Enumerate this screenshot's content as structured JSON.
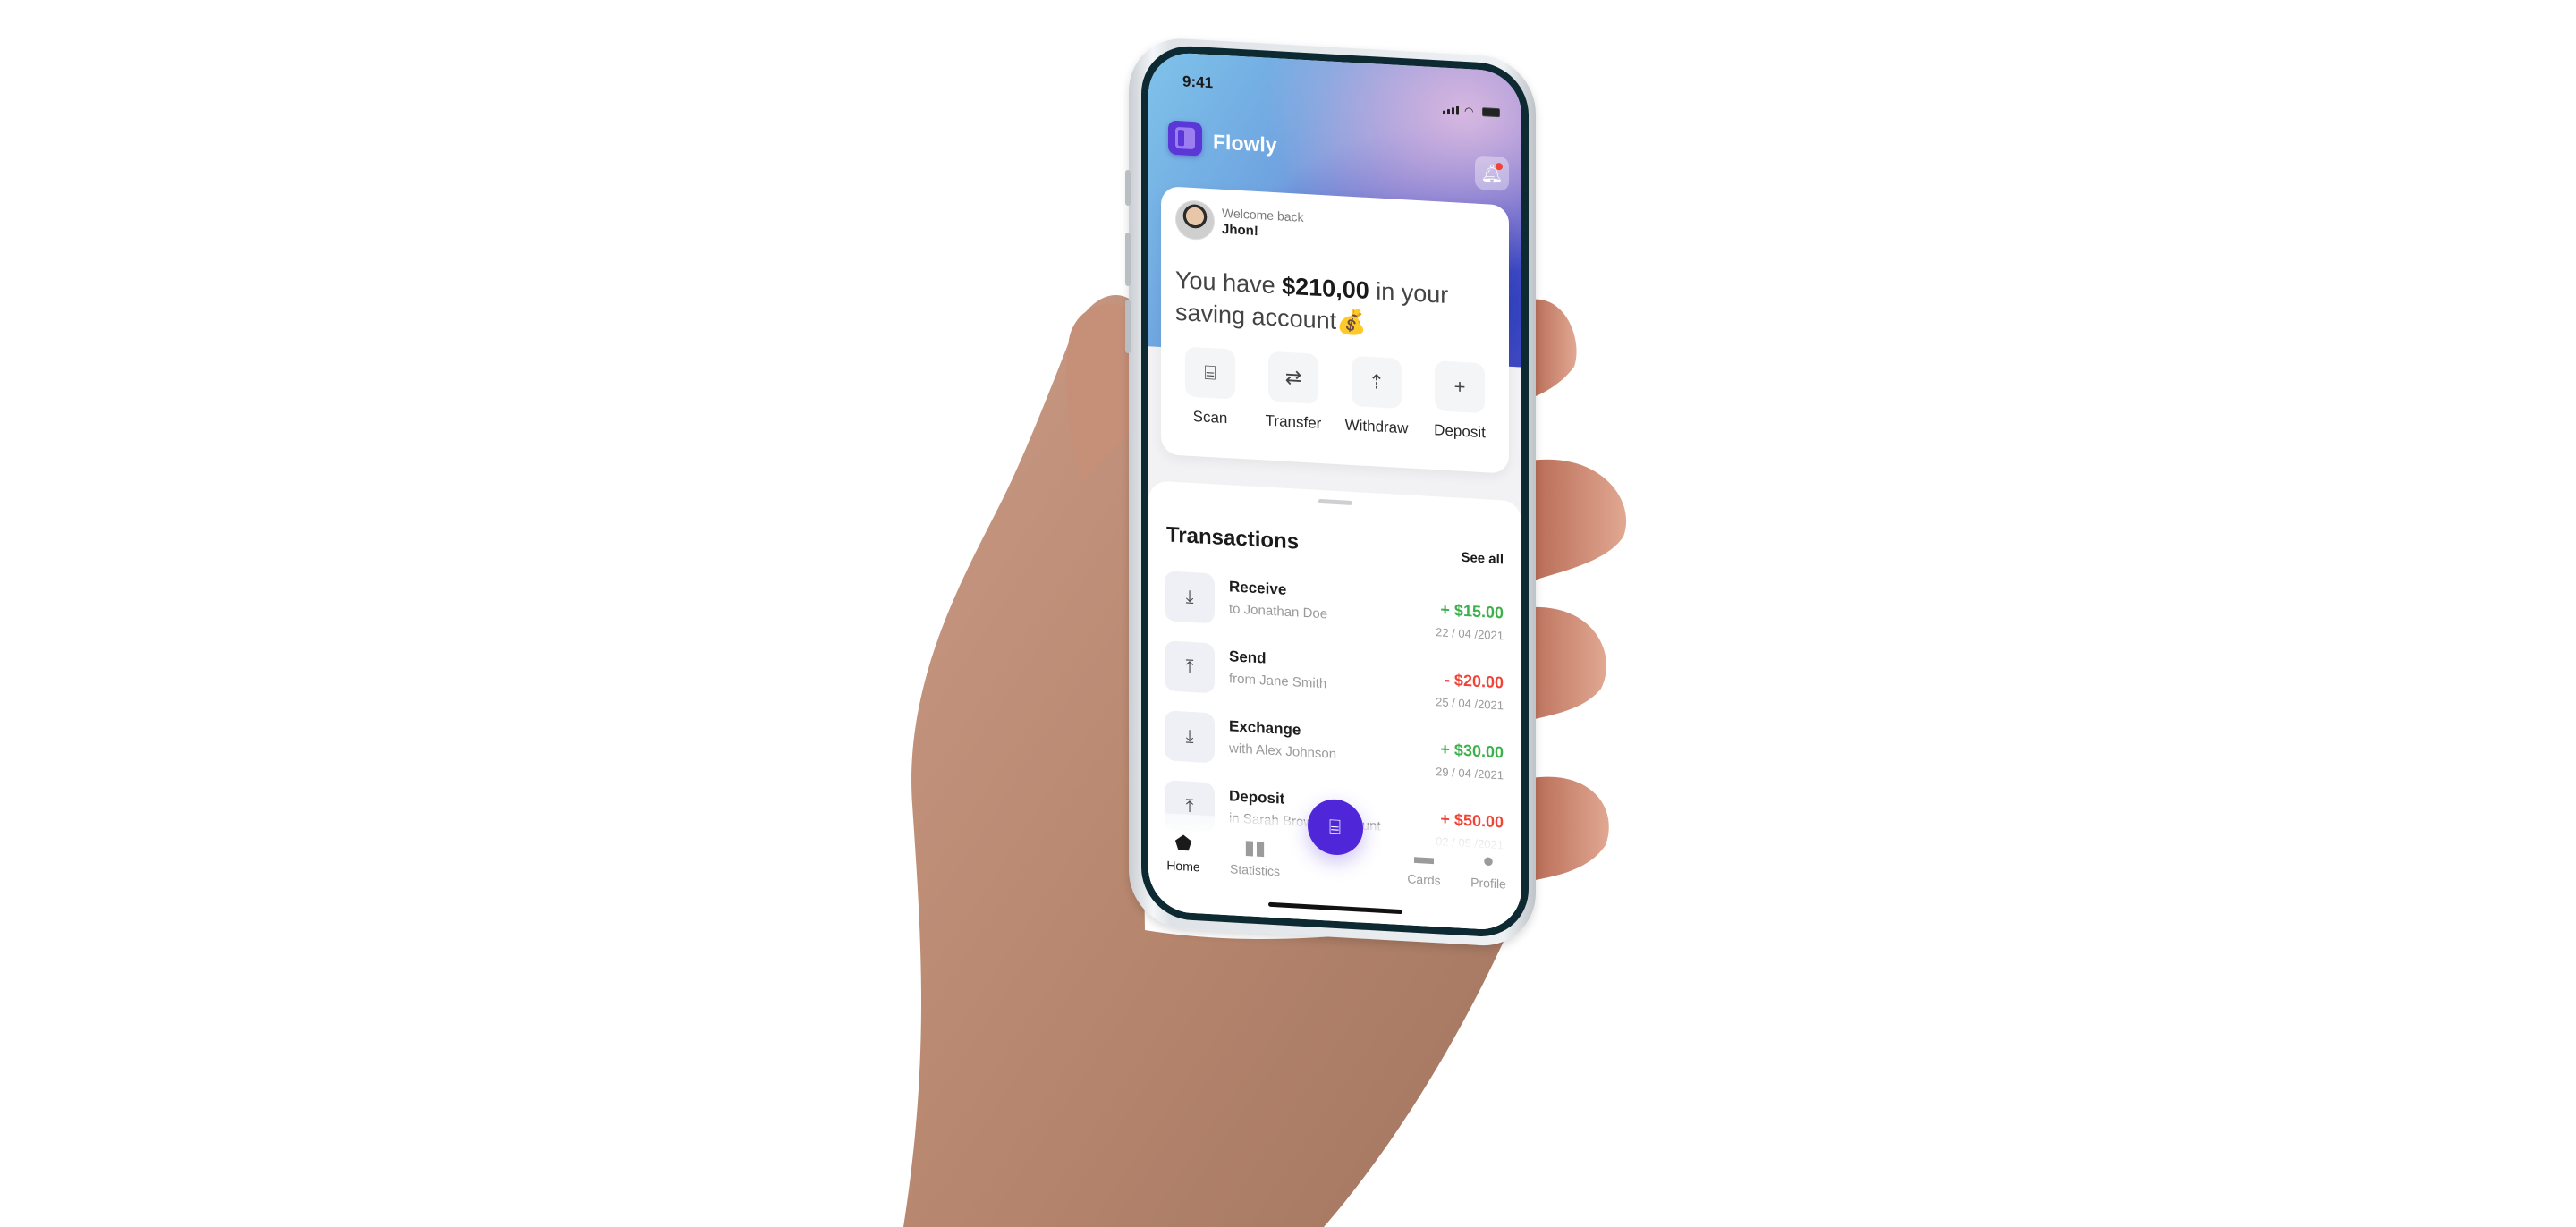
{
  "status_bar": {
    "time": "9:41"
  },
  "app": {
    "name": "Flowly",
    "brand_color": "#5026d9"
  },
  "header": {
    "notification_icon": "bell-icon",
    "has_unread": true
  },
  "greeting": {
    "welcome": "Welcome back",
    "user_name": "Jhon!"
  },
  "balance": {
    "prefix": "You have ",
    "amount": "$210,00",
    "suffix": " in your saving account",
    "emoji": "💰"
  },
  "quick_actions": [
    {
      "label": "Scan",
      "icon": "scan-icon"
    },
    {
      "label": "Transfer",
      "icon": "transfer-icon"
    },
    {
      "label": "Withdraw",
      "icon": "withdraw-icon"
    },
    {
      "label": "Deposit",
      "icon": "deposit-icon"
    }
  ],
  "transactions": {
    "title": "Transactions",
    "see_all": "See all",
    "items": [
      {
        "name": "Receive",
        "sub": "to Jonathan Doe",
        "amount": "+ $15.00",
        "date": "22 / 04 /2021",
        "type": "positive",
        "icon": "receive-icon"
      },
      {
        "name": "Send",
        "sub": "from Jane Smith",
        "amount": "- $20.00",
        "date": "25 / 04 /2021",
        "type": "negative",
        "icon": "send-icon"
      },
      {
        "name": "Exchange",
        "sub": "with Alex Johnson",
        "amount": "+ $30.00",
        "date": "29 / 04 /2021",
        "type": "positive",
        "icon": "exchange-icon"
      },
      {
        "name": "Deposit",
        "sub": "in Sarah Brown's account",
        "amount": "+ $50.00",
        "date": "02 / 05 /2021",
        "type": "negative",
        "icon": "deposit-icon"
      }
    ]
  },
  "tabbar": {
    "tabs": [
      {
        "label": "Home",
        "icon": "home-icon",
        "active": true
      },
      {
        "label": "Statistics",
        "icon": "statistics-icon",
        "active": false
      },
      {
        "label": "Cards",
        "icon": "cards-icon",
        "active": false
      },
      {
        "label": "Profile",
        "icon": "profile-icon",
        "active": false
      }
    ],
    "center_action_icon": "scan-icon"
  },
  "colors": {
    "positive": "#3cb04b",
    "negative": "#f04438"
  }
}
